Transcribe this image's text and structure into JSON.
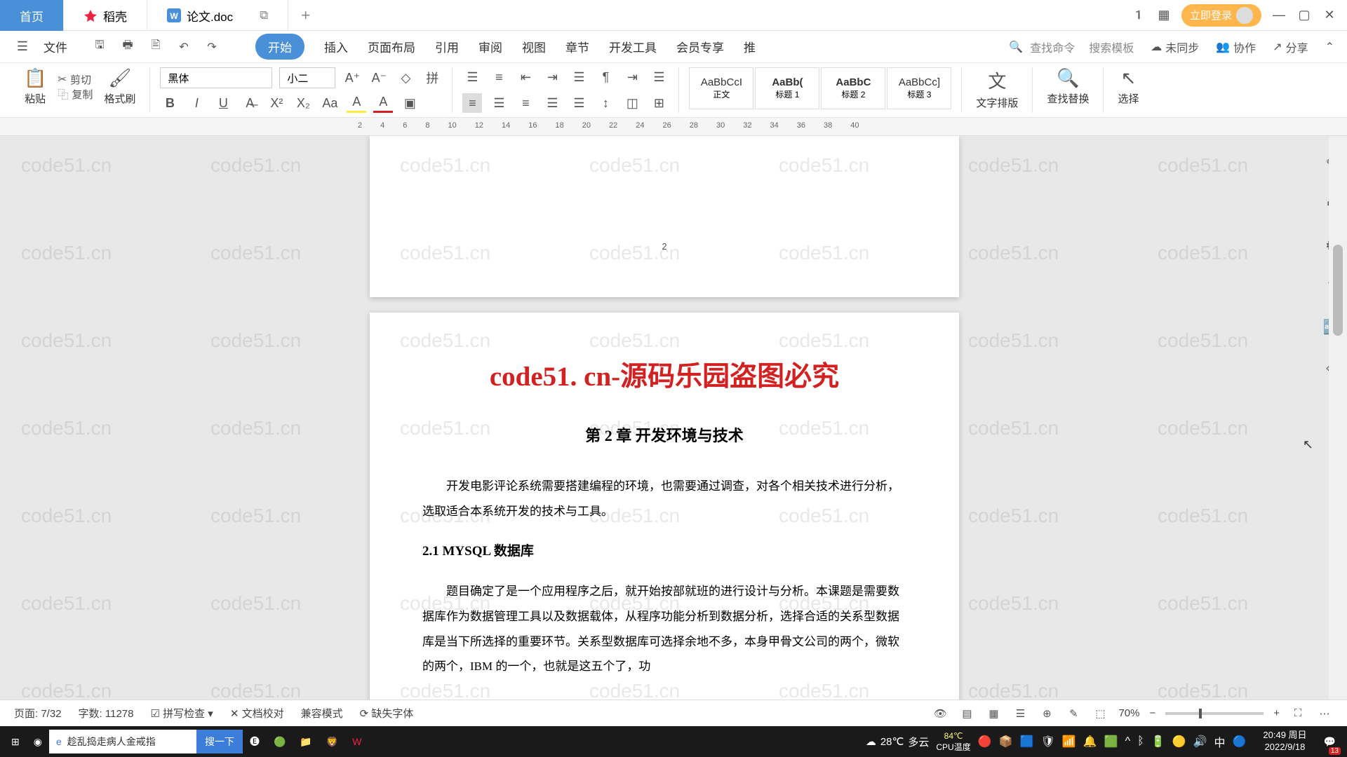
{
  "tabs": {
    "home": "首页",
    "daoke": "稻壳",
    "doc": "论文.doc"
  },
  "titlebar": {
    "login": "立即登录"
  },
  "menubar": {
    "file": "文件",
    "ribbonTabs": [
      "开始",
      "插入",
      "页面布局",
      "引用",
      "审阅",
      "视图",
      "章节",
      "开发工具",
      "会员专享",
      "推"
    ],
    "search1": "查找命令",
    "search2": "搜索模板",
    "unsync": "未同步",
    "coop": "协作",
    "share": "分享"
  },
  "ribbon": {
    "paste": "粘贴",
    "cut": "剪切",
    "copy": "复制",
    "format": "格式刷",
    "font": "黑体",
    "size": "小二",
    "styles": [
      {
        "preview": "AaBbCcI",
        "name": "正文"
      },
      {
        "preview": "AaBb(",
        "name": "标题 1"
      },
      {
        "preview": "AaBbC",
        "name": "标题 2"
      },
      {
        "preview": "AaBbCc]",
        "name": "标题 3"
      }
    ],
    "layout": "文字排版",
    "find": "查找替换",
    "select": "选择"
  },
  "doc": {
    "pgnum": "2",
    "watermark": "code51. cn-源码乐园盗图必究",
    "chapter": "第 2 章  开发环境与技术",
    "intro": "开发电影评论系统需要搭建编程的环境，也需要通过调查，对各个相关技术进行分析，选取适合本系统开发的技术与工具。",
    "section": "2.1 MYSQL 数据库",
    "body": "题目确定了是一个应用程序之后，就开始按部就班的进行设计与分析。本课题是需要数据库作为数据管理工具以及数据载体，从程序功能分析到数据分析，选择合适的关系型数据库是当下所选择的重要环节。关系型数据库可选择余地不多，本身甲骨文公司的两个，微软的两个，IBM 的一个，也就是这五个了，功"
  },
  "status": {
    "page": "页面: 7/32",
    "words": "字数: 11278",
    "spell": "拼写检查",
    "proof": "文档校对",
    "compat": "兼容模式",
    "missing": "缺失字体",
    "zoom": "70%"
  },
  "taskbar": {
    "searchText": "趁乱捣走病人金戒指",
    "searchBtn": "搜一下",
    "temp": "28℃",
    "weather": "多云",
    "cpu": "84℃",
    "cpuLabel": "CPU温度",
    "ime": "中",
    "time": "20:49 周日",
    "date": "2022/9/18",
    "notif": "13"
  },
  "bgwm": "code51.cn"
}
